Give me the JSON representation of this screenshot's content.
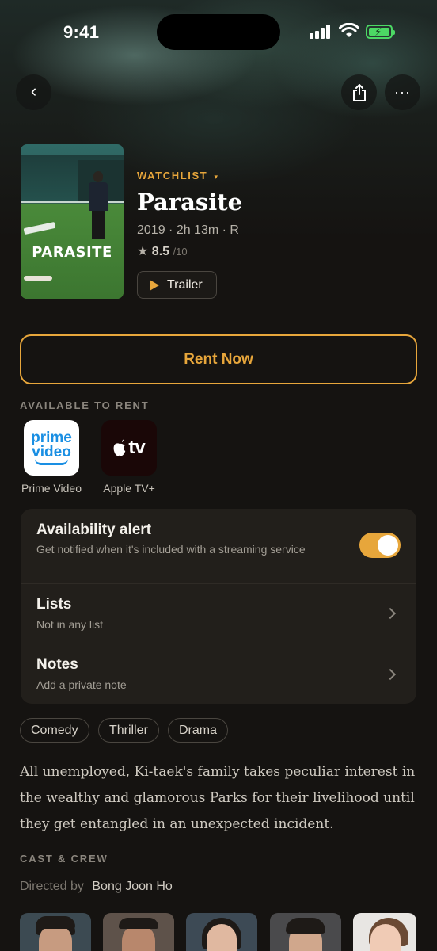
{
  "status_bar": {
    "time": "9:41"
  },
  "header": {
    "back_icon": "chevron-left-icon",
    "share_icon": "share-icon",
    "more_icon": "ellipsis-icon",
    "back_glyph": "‹",
    "more_glyph": "···"
  },
  "movie": {
    "poster_title": "PARASITE",
    "watchlist_label": "WATCHLIST",
    "watchlist_caret": "▾",
    "title": "Parasite",
    "meta": "2019 · 2h 13m · R",
    "rating_star": "★",
    "rating_value": "8.5",
    "rating_scale": "/10",
    "trailer_label": "Trailer"
  },
  "rent_button_label": "Rent Now",
  "available": {
    "label": "AVAILABLE TO RENT",
    "providers": [
      {
        "name": "Prime Video",
        "logo_line1": "prime",
        "logo_line2": "video"
      },
      {
        "name": "Apple TV+",
        "logo_text": "tv"
      }
    ]
  },
  "settings": {
    "alert": {
      "title": "Availability alert",
      "subtitle": "Get notified when it's included with a streaming service",
      "enabled": true
    },
    "lists": {
      "title": "Lists",
      "subtitle": "Not in any list"
    },
    "notes": {
      "title": "Notes",
      "subtitle": "Add a private note"
    }
  },
  "genres": [
    "Comedy",
    "Thriller",
    "Drama"
  ],
  "description": "All unemployed, Ki-taek's family takes peculiar interest in the wealthy and glamorous Parks for their livelihood until they get entangled in an unexpected incident.",
  "cast_crew": {
    "label": "CAST & CREW",
    "directed_by_label": "Directed by",
    "director": "Bong Joon Ho"
  },
  "colors": {
    "accent": "#e7a63b",
    "background": "#151311",
    "card": "#221f1b"
  }
}
